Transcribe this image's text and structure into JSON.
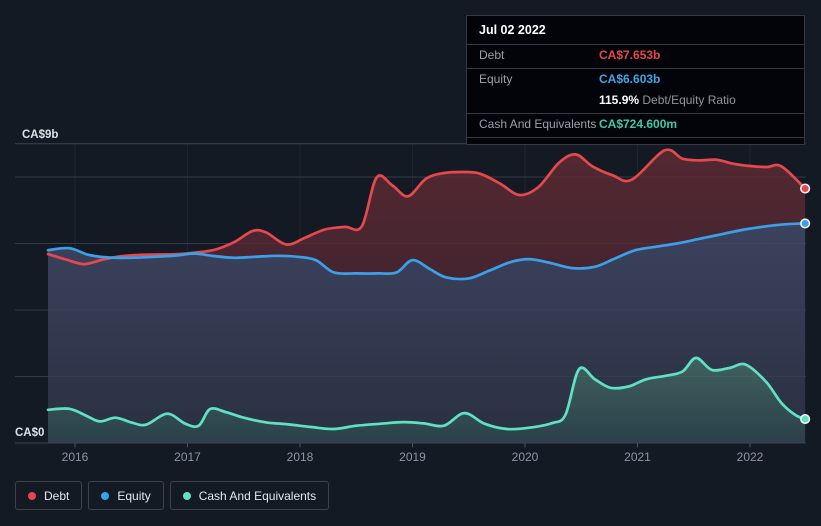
{
  "tooltip": {
    "date": "Jul 02 2022",
    "debt": {
      "label": "Debt",
      "value": "CA$7.653b",
      "color": "#e8484d"
    },
    "equity": {
      "label": "Equity",
      "value": "CA$6.603b",
      "color": "#41a6e8"
    },
    "ratio": {
      "value": "115.9%",
      "label": "Debt/Equity Ratio"
    },
    "cash": {
      "label": "Cash And Equivalents",
      "value": "CA$724.600m",
      "color": "#40c8ae"
    }
  },
  "legend": {
    "items": [
      {
        "id": "debt",
        "label": "Debt",
        "color": "#e5484d"
      },
      {
        "id": "equity",
        "label": "Equity",
        "color": "#3ba0e8"
      },
      {
        "id": "cash",
        "label": "Cash And Equivalents",
        "color": "#5fe2c4"
      }
    ]
  },
  "chart_data": {
    "type": "area",
    "unit": "CA$ billions",
    "grid": true,
    "legend_position": "bottom-left",
    "y_axis": {
      "min": 0,
      "max": 9,
      "top_label": "CA$9b",
      "bottom_label": "CA$0",
      "gridline_values": [
        8,
        6,
        4,
        2
      ]
    },
    "x_axis": {
      "tick_years": [
        2016,
        2017,
        2018,
        2019,
        2020,
        2021,
        2022
      ],
      "range": [
        2015.76,
        2022.49
      ]
    },
    "series": [
      {
        "id": "debt",
        "name": "Debt",
        "color": "#e5484d",
        "fill_top": "#532831",
        "fill_bottom": "#33202d",
        "points": [
          [
            2015.76,
            5.68
          ],
          [
            2015.92,
            5.52
          ],
          [
            2016.08,
            5.38
          ],
          [
            2016.25,
            5.52
          ],
          [
            2016.42,
            5.62
          ],
          [
            2016.58,
            5.66
          ],
          [
            2016.75,
            5.67
          ],
          [
            2016.92,
            5.68
          ],
          [
            2017.08,
            5.73
          ],
          [
            2017.25,
            5.82
          ],
          [
            2017.42,
            6.05
          ],
          [
            2017.58,
            6.38
          ],
          [
            2017.7,
            6.33
          ],
          [
            2017.88,
            5.97
          ],
          [
            2018.05,
            6.18
          ],
          [
            2018.22,
            6.42
          ],
          [
            2018.4,
            6.5
          ],
          [
            2018.55,
            6.52
          ],
          [
            2018.68,
            7.98
          ],
          [
            2018.82,
            7.75
          ],
          [
            2018.96,
            7.42
          ],
          [
            2019.12,
            7.95
          ],
          [
            2019.28,
            8.12
          ],
          [
            2019.45,
            8.15
          ],
          [
            2019.6,
            8.1
          ],
          [
            2019.78,
            7.8
          ],
          [
            2019.95,
            7.46
          ],
          [
            2020.12,
            7.7
          ],
          [
            2020.3,
            8.42
          ],
          [
            2020.45,
            8.68
          ],
          [
            2020.6,
            8.32
          ],
          [
            2020.78,
            8.05
          ],
          [
            2020.95,
            7.92
          ],
          [
            2021.24,
            8.8
          ],
          [
            2021.4,
            8.55
          ],
          [
            2021.55,
            8.5
          ],
          [
            2021.7,
            8.52
          ],
          [
            2021.85,
            8.4
          ],
          [
            2022.0,
            8.33
          ],
          [
            2022.15,
            8.3
          ],
          [
            2022.28,
            8.32
          ],
          [
            2022.49,
            7.653
          ]
        ]
      },
      {
        "id": "equity",
        "name": "Equity",
        "color": "#3ba0e8",
        "fill_top": "#3c425e",
        "fill_bottom": "#293040",
        "points": [
          [
            2015.76,
            5.8
          ],
          [
            2015.95,
            5.86
          ],
          [
            2016.12,
            5.66
          ],
          [
            2016.3,
            5.58
          ],
          [
            2016.5,
            5.57
          ],
          [
            2016.7,
            5.6
          ],
          [
            2016.9,
            5.64
          ],
          [
            2017.06,
            5.7
          ],
          [
            2017.24,
            5.62
          ],
          [
            2017.42,
            5.57
          ],
          [
            2017.6,
            5.6
          ],
          [
            2017.8,
            5.63
          ],
          [
            2017.98,
            5.6
          ],
          [
            2018.14,
            5.5
          ],
          [
            2018.3,
            5.13
          ],
          [
            2018.5,
            5.1
          ],
          [
            2018.7,
            5.1
          ],
          [
            2018.86,
            5.13
          ],
          [
            2019.0,
            5.5
          ],
          [
            2019.16,
            5.22
          ],
          [
            2019.3,
            4.98
          ],
          [
            2019.5,
            4.95
          ],
          [
            2019.68,
            5.18
          ],
          [
            2019.88,
            5.45
          ],
          [
            2020.04,
            5.53
          ],
          [
            2020.22,
            5.42
          ],
          [
            2020.42,
            5.26
          ],
          [
            2020.62,
            5.3
          ],
          [
            2020.8,
            5.55
          ],
          [
            2020.98,
            5.8
          ],
          [
            2021.16,
            5.9
          ],
          [
            2021.35,
            6.0
          ],
          [
            2021.55,
            6.14
          ],
          [
            2021.75,
            6.28
          ],
          [
            2021.95,
            6.42
          ],
          [
            2022.15,
            6.52
          ],
          [
            2022.32,
            6.58
          ],
          [
            2022.49,
            6.603
          ]
        ]
      },
      {
        "id": "cash",
        "name": "Cash And Equivalents",
        "color": "#5fe2c4",
        "fill_top": "#41615f",
        "fill_bottom": "#2a404a",
        "points": [
          [
            2015.76,
            1.0
          ],
          [
            2015.95,
            1.03
          ],
          [
            2016.1,
            0.82
          ],
          [
            2016.22,
            0.65
          ],
          [
            2016.36,
            0.76
          ],
          [
            2016.5,
            0.62
          ],
          [
            2016.63,
            0.55
          ],
          [
            2016.82,
            0.88
          ],
          [
            2016.98,
            0.58
          ],
          [
            2017.1,
            0.52
          ],
          [
            2017.2,
            1.02
          ],
          [
            2017.34,
            0.93
          ],
          [
            2017.5,
            0.76
          ],
          [
            2017.7,
            0.62
          ],
          [
            2017.9,
            0.56
          ],
          [
            2018.1,
            0.48
          ],
          [
            2018.3,
            0.42
          ],
          [
            2018.5,
            0.52
          ],
          [
            2018.72,
            0.58
          ],
          [
            2018.92,
            0.63
          ],
          [
            2019.1,
            0.59
          ],
          [
            2019.28,
            0.52
          ],
          [
            2019.46,
            0.9
          ],
          [
            2019.64,
            0.58
          ],
          [
            2019.84,
            0.42
          ],
          [
            2020.04,
            0.46
          ],
          [
            2020.24,
            0.6
          ],
          [
            2020.36,
            0.85
          ],
          [
            2020.48,
            2.22
          ],
          [
            2020.62,
            1.92
          ],
          [
            2020.76,
            1.66
          ],
          [
            2020.92,
            1.7
          ],
          [
            2021.08,
            1.92
          ],
          [
            2021.25,
            2.02
          ],
          [
            2021.4,
            2.15
          ],
          [
            2021.52,
            2.56
          ],
          [
            2021.66,
            2.2
          ],
          [
            2021.82,
            2.26
          ],
          [
            2021.96,
            2.36
          ],
          [
            2022.14,
            1.85
          ],
          [
            2022.28,
            1.2
          ],
          [
            2022.4,
            0.85
          ],
          [
            2022.49,
            0.72
          ]
        ]
      }
    ]
  }
}
